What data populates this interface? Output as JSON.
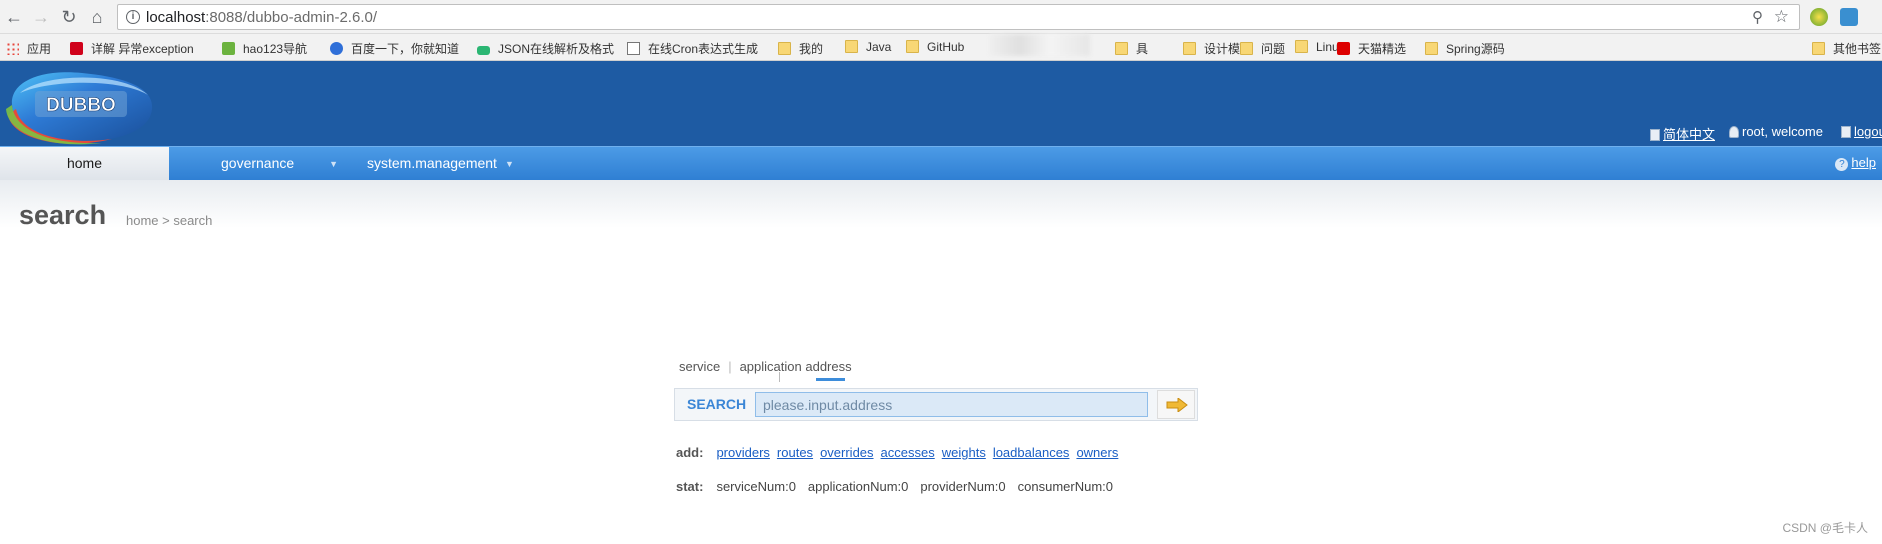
{
  "browser": {
    "url_host": "localhost",
    "url_rest": ":8088/dubbo-admin-2.6.0/",
    "bookmarks": [
      {
        "label": "应用",
        "icon": "apps-icon"
      },
      {
        "label": "详解 异常exception",
        "icon": "c-red-icon"
      },
      {
        "label": "hao123导航",
        "icon": "hao123-icon"
      },
      {
        "label": "百度一下，你就知道",
        "icon": "baidu-paw-icon"
      },
      {
        "label": "JSON在线解析及格式",
        "icon": "json-icon"
      },
      {
        "label": "在线Cron表达式生成",
        "icon": "page-icon"
      },
      {
        "label": "我的",
        "icon": "folder-icon"
      },
      {
        "label": "Java",
        "icon": "folder-icon"
      },
      {
        "label": "GitHub",
        "icon": "folder-icon"
      },
      {
        "label": "具",
        "icon": "folder-icon"
      },
      {
        "label": "设计模式",
        "icon": "folder-icon"
      },
      {
        "label": "问题",
        "icon": "folder-icon"
      },
      {
        "label": "Linux",
        "icon": "folder-icon"
      },
      {
        "label": "天猫精选",
        "icon": "tmall-icon"
      },
      {
        "label": "Spring源码",
        "icon": "folder-icon"
      },
      {
        "label": "其他书签",
        "icon": "folder-icon"
      }
    ]
  },
  "header": {
    "logo_text": "DUBBO",
    "lang": "简体中文",
    "user": "root, welcome",
    "logout": "logout"
  },
  "menu": {
    "home": "home",
    "governance": "governance",
    "system": "system.management",
    "help": "help"
  },
  "page": {
    "title": "search",
    "breadcrumb": "home > search"
  },
  "search": {
    "tabs": [
      "service",
      "application",
      "address"
    ],
    "label": "SEARCH",
    "placeholder": "please.input.address"
  },
  "add": {
    "label": "add:",
    "links": [
      "providers",
      "routes",
      "overrides",
      "accesses",
      "weights",
      "loadbalances",
      "owners"
    ]
  },
  "stat": {
    "label": "stat:",
    "items": [
      "serviceNum:0",
      "applicationNum:0",
      "providerNum:0",
      "consumerNum:0"
    ]
  },
  "watermark": "CSDN @毛卡人",
  "colors": {
    "header": "#1e5ba3",
    "menu": "#3a8ae0",
    "link": "#1a5ec4"
  }
}
